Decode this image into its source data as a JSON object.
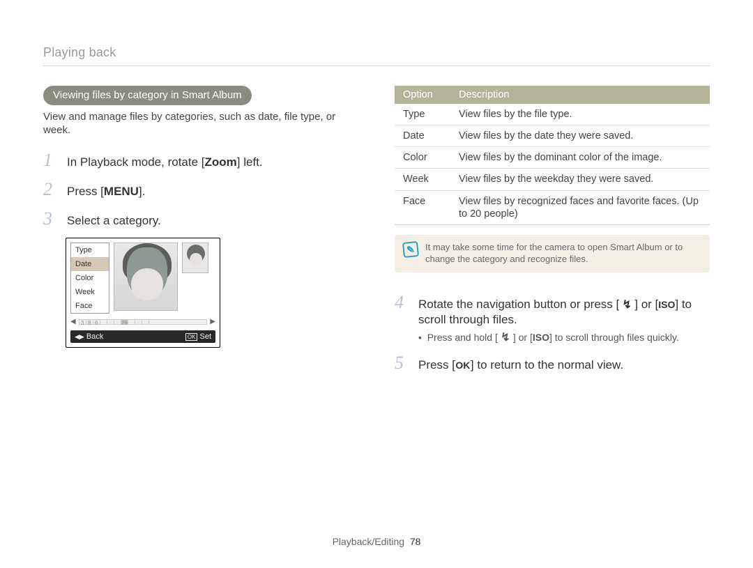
{
  "breadcrumb": "Playing back",
  "pill": "Viewing files by category in Smart Album",
  "intro": "View and manage files by categories, such as date, file type, or week.",
  "leftSteps": {
    "s1_pre": "In Playback mode, rotate [",
    "s1_key": "Zoom",
    "s1_post": "] left.",
    "s2_pre": "Press [",
    "s2_key": "MENU",
    "s2_post": "].",
    "s3": "Select a category."
  },
  "cam": {
    "menu": [
      "Type",
      "Date",
      "Color",
      "Week",
      "Face"
    ],
    "selectedIndex": 1,
    "stripValues": [
      "3",
      "8",
      "6",
      "",
      "",
      "",
      "29",
      "",
      "",
      ""
    ],
    "back": "Back",
    "set": "Set",
    "ok": "OK"
  },
  "tableHeader": {
    "c1": "Option",
    "c2": "Description"
  },
  "tableRows": [
    {
      "opt": "Type",
      "desc": "View files by the file type."
    },
    {
      "opt": "Date",
      "desc": "View files by the date they were saved."
    },
    {
      "opt": "Color",
      "desc": "View files by the dominant color of the image."
    },
    {
      "opt": "Week",
      "desc": "View files by the weekday they were saved."
    },
    {
      "opt": "Face",
      "desc": "View files by recognized faces and favorite faces. (Up to 20 people)"
    }
  ],
  "note": "It may take some time for the camera to open Smart Album or to change the category and recognize files.",
  "rightSteps": {
    "s4_a": "Rotate the navigation button or press [",
    "s4_b": "] or [",
    "s4_c": "] to scroll through files.",
    "s4_bullet_a": "Press and hold [",
    "s4_bullet_b": "] or [",
    "s4_bullet_c": "] to scroll through files quickly.",
    "s5_a": "Press [",
    "s5_b": "] to return to the normal view."
  },
  "glyphs": {
    "flash": "↯",
    "iso": "ISO",
    "ok": "OK",
    "menu": "MENU"
  },
  "footer": {
    "section": "Playback/Editing",
    "page": "78"
  }
}
